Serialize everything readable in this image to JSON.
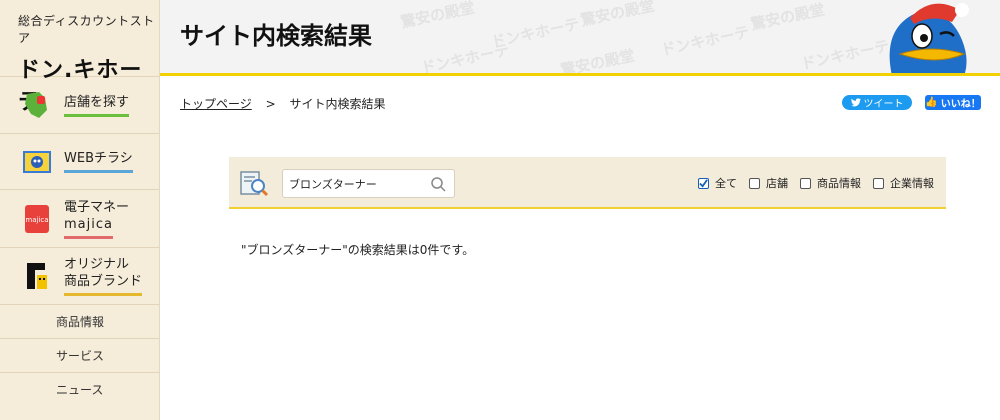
{
  "brand": {
    "subtitle": "総合ディスカウントストア",
    "logo": "ドン.キホーテ"
  },
  "sidebar": {
    "items": [
      {
        "label": "店舗を探す",
        "icon": "map-pin-icon"
      },
      {
        "label": "WEBチラシ",
        "icon": "flyer-icon"
      },
      {
        "label_line1": "電子マネー",
        "label_line2": "majica",
        "icon": "majica-card-icon"
      },
      {
        "label_line1": "オリジナル",
        "label_line2": "商品ブランド",
        "icon": "brand-logo-icon"
      }
    ],
    "sub_items": [
      "商品情報",
      "サービス",
      "ニュース"
    ]
  },
  "header": {
    "title": "サイト内検索結果",
    "watermark": "ドンキホーテ",
    "watermark_alt": "驚安の殿堂"
  },
  "breadcrumb": {
    "home": "トップページ",
    "separator": ">",
    "current": "サイト内検索結果"
  },
  "social": {
    "tweet": "ツイート",
    "like": "いいね！"
  },
  "search": {
    "value": "ブロンズターナー",
    "filters": [
      {
        "label": "全て",
        "checked": true
      },
      {
        "label": "店舗",
        "checked": false
      },
      {
        "label": "商品情報",
        "checked": false
      },
      {
        "label": "企業情報",
        "checked": false
      }
    ]
  },
  "result": {
    "message": "\"ブロンズターナー\"の検索結果は0件です。"
  },
  "colors": {
    "accent_yellow": "#f2d100",
    "sidebar_bg": "#f5ecd9",
    "tweet_blue": "#1d9bf0",
    "like_blue": "#1877f2"
  }
}
